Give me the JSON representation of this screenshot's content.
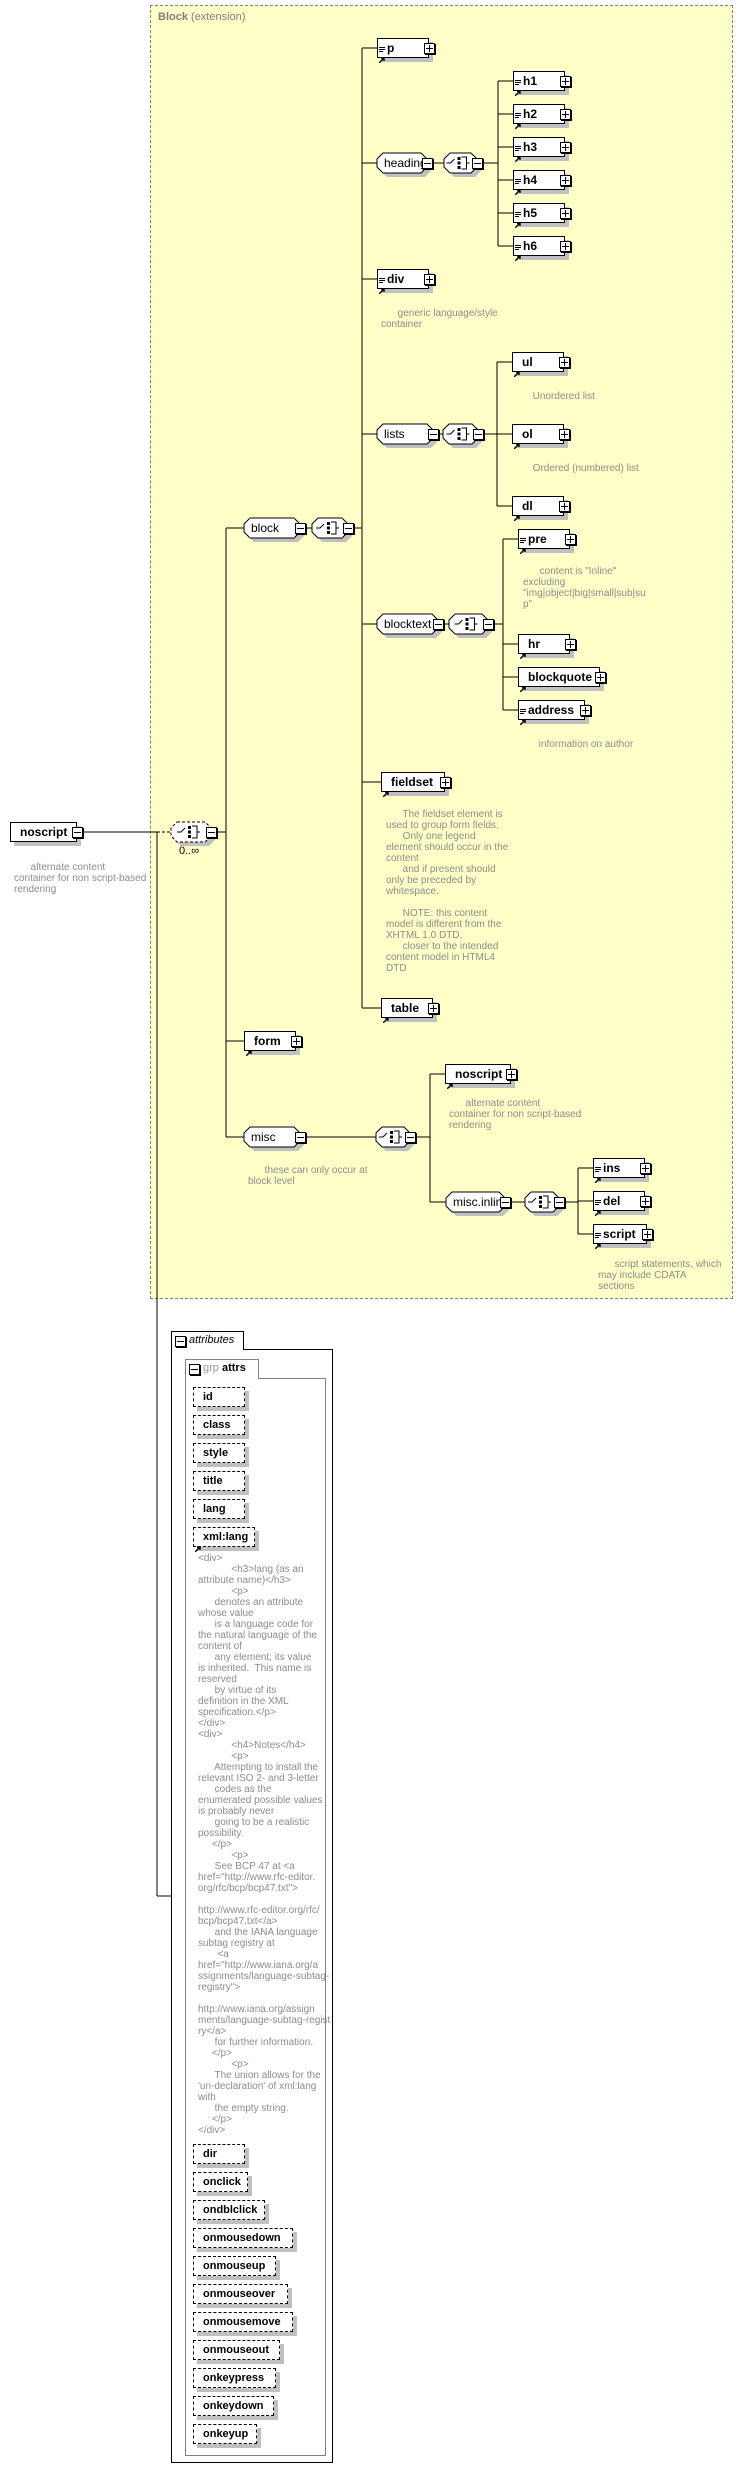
{
  "diagram": {
    "block_title": "Block",
    "block_subtitle": "(extension)",
    "root": {
      "label": "noscript",
      "doc": "      alternate content\ncontainer for non script-based\nrendering"
    },
    "root_cardinality": "0..∞",
    "nodes": {
      "block": "block",
      "p": "p",
      "heading": "heading",
      "h1": "h1",
      "h2": "h2",
      "h3": "h3",
      "h4": "h4",
      "h5": "h5",
      "h6": "h6",
      "div": "div",
      "lists": "lists",
      "ul": "ul",
      "ol": "ol",
      "dl": "dl",
      "blocktext": "blocktext",
      "pre": "pre",
      "hr": "hr",
      "blockquote": "blockquote",
      "address": "address",
      "fieldset": "fieldset",
      "table": "table",
      "form": "form",
      "misc": "misc",
      "noscript": "noscript",
      "misc_inline": "misc.inline",
      "ins": "ins",
      "del": "del",
      "script": "script"
    },
    "docs": {
      "div": "      generic language/style\ncontainer",
      "ul": "      Unordered list",
      "ol": "      Ordered (numbered) list",
      "pre": "      content is \"Inline\"\nexcluding\n\"img|object|big|small|sub|su\np\"",
      "address": "      information on author",
      "fieldset": "      The fieldset element is\nused to group form fields.\n      Only one legend\nelement should occur in the\ncontent\n      and if present should\nonly be preceded by\nwhitespace.\n\n      NOTE: this content\nmodel is different from the\nXHTML 1.0 DTD,\n      closer to the intended\ncontent model in HTML4\nDTD",
      "misc": "      these can only occur at\nblock level",
      "noscript": "      alternate content\ncontainer for non script-based\nrendering",
      "script": "      script statements, which\nmay include CDATA\nsections"
    },
    "colors": {
      "block_background": "#ffffc8",
      "doc_text": "#8c8c8c",
      "shadow": "#c0c0c0"
    }
  },
  "attributes": {
    "tab_label": "attributes",
    "group_prefix": "grp",
    "group_name": "attrs",
    "items": [
      "id",
      "class",
      "style",
      "title",
      "lang",
      "xml:lang",
      "dir",
      "onclick",
      "ondblclick",
      "onmousedown",
      "onmouseup",
      "onmouseover",
      "onmousemove",
      "onmouseout",
      "onkeypress",
      "onkeydown",
      "onkeyup"
    ],
    "xml_lang_doc": "<div>\n            <h3>lang (as an\nattribute name)</h3>\n            <p>\n      denotes an attribute\nwhose value\n      is a language code for\nthe natural language of the\ncontent of\n      any element; its value\nis inherited.  This name is\nreserved\n      by virtue of its\ndefinition in the XML\nspecification.</p>\n</div>\n<div>\n            <h4>Notes</h4>\n            <p>\n      Attempting to install the\nrelevant ISO 2- and 3-letter\n      codes as the\nenumerated possible values\nis probably never\n      going to be a realistic\npossibility.\n     </p>\n            <p>\n      See BCP 47 at <a\nhref=\"http://www.rfc-editor.\norg/rfc/bcp/bcp47.txt\">\n\nhttp://www.rfc-editor.org/rfc/\nbcp/bcp47.txt</a>\n      and the IANA language\nsubtag registry at\n       <a\nhref=\"http://www.iana.org/a\nssignments/language-subtag-\nregistry\">\n\nhttp://www.iana.org/assign\nments/language-subtag-regist\nry</a>\n      for further information.\n     </p>\n            <p>\n      The union allows for the\n'un-declaration' of xml:lang\nwith\n      the empty string.\n     </p>\n</div>"
  }
}
